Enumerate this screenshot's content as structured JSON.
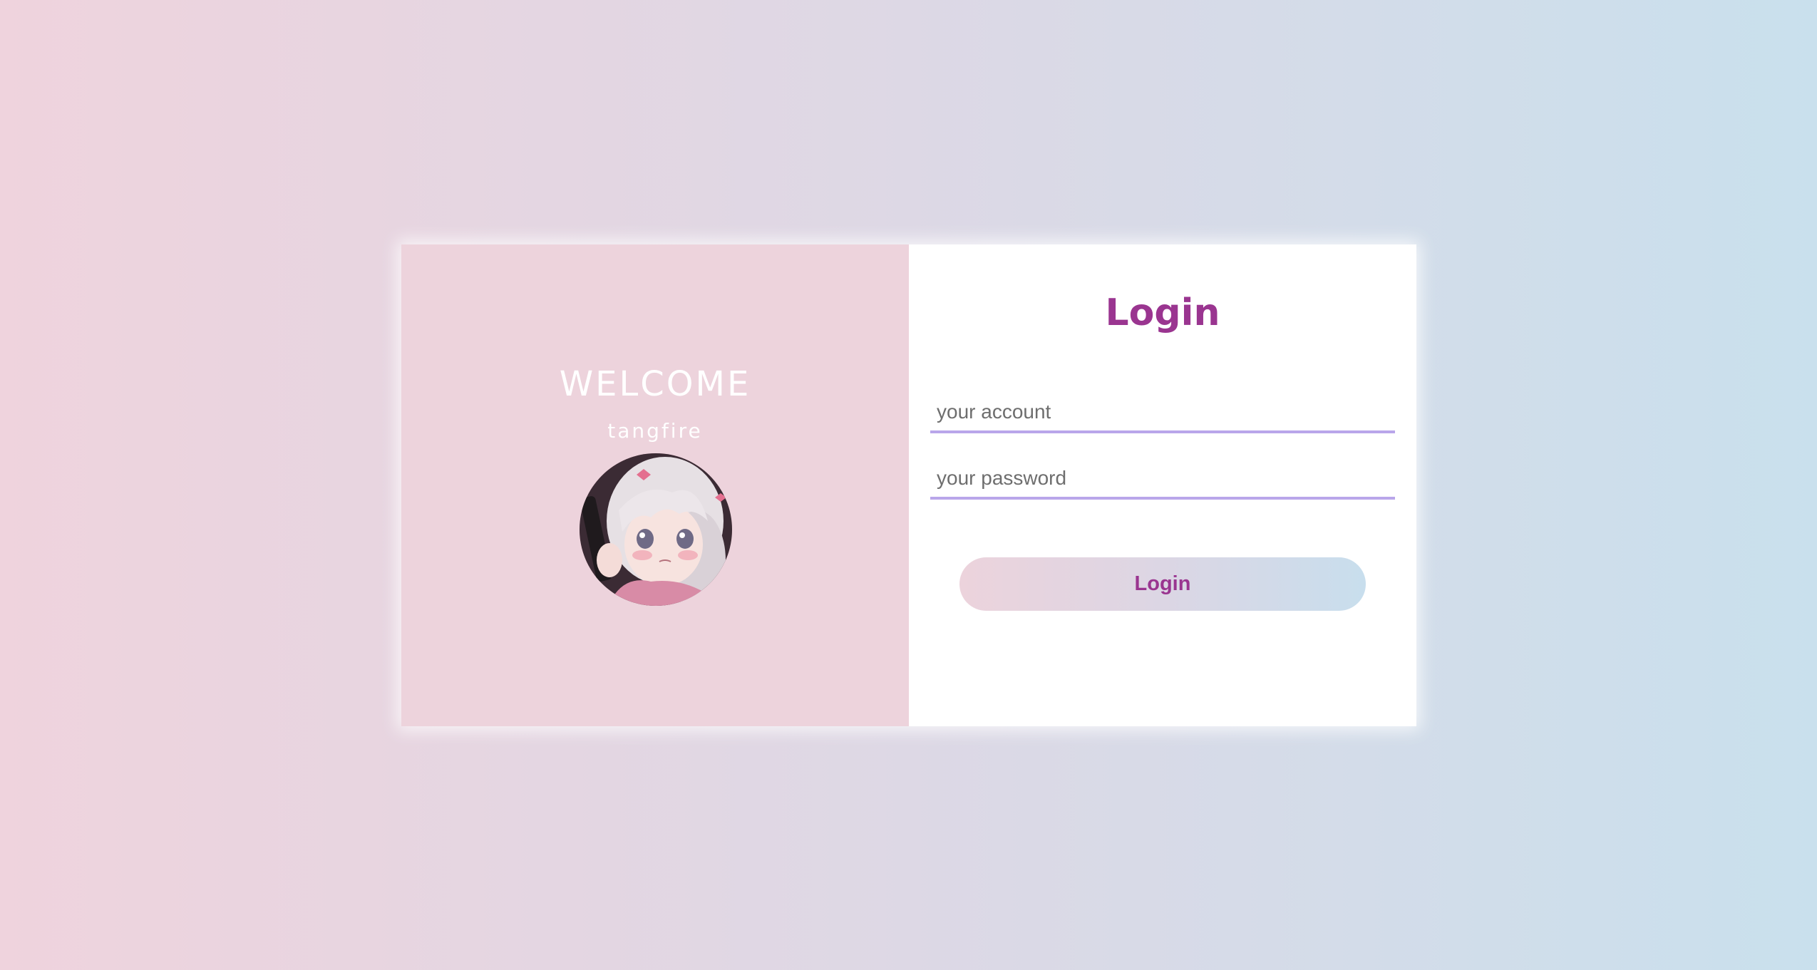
{
  "welcome_panel": {
    "heading": "WELCOME",
    "subtitle": "tangfire"
  },
  "login_panel": {
    "title": "Login",
    "account_placeholder": "your account",
    "password_placeholder": "your password",
    "submit_label": "Login"
  },
  "colors": {
    "accent": "#9a3590",
    "input_underline": "#b9a6ea",
    "left_panel_bg": "#edd3dc"
  },
  "icons": {
    "avatar": "anime-avatar-image"
  }
}
